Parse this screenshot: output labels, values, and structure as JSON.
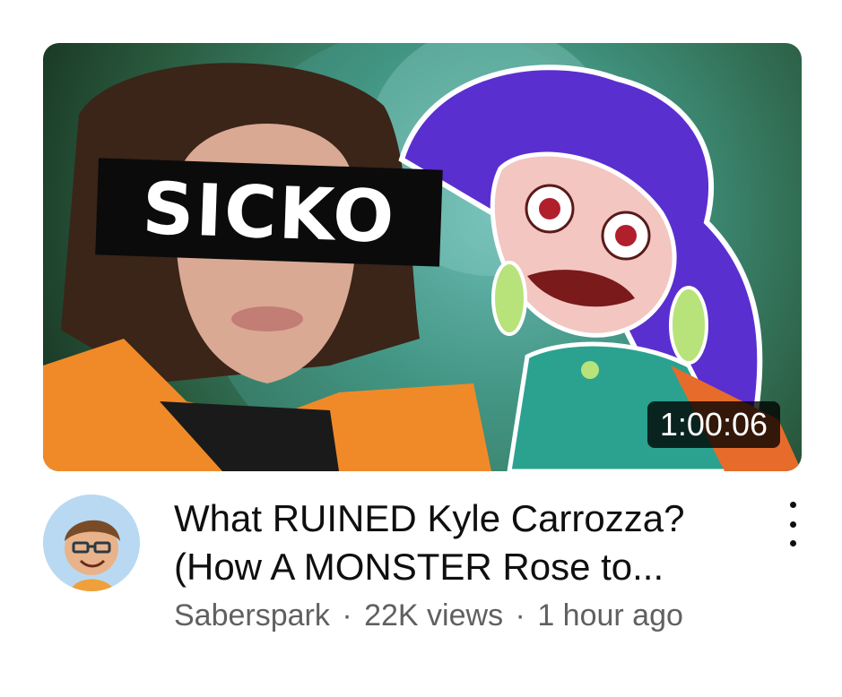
{
  "video": {
    "thumbnail_overlay_text": "SICKO",
    "duration": "1:00:06",
    "title_line1": "What RUINED Kyle Carrozza?",
    "title_line2": "(How A MONSTER Rose to...",
    "channel": "Saberspark",
    "views": "22K views",
    "age": "1 hour ago",
    "separator": "·"
  },
  "icons": {
    "more": "more-vertical-icon",
    "avatar": "channel-avatar"
  }
}
